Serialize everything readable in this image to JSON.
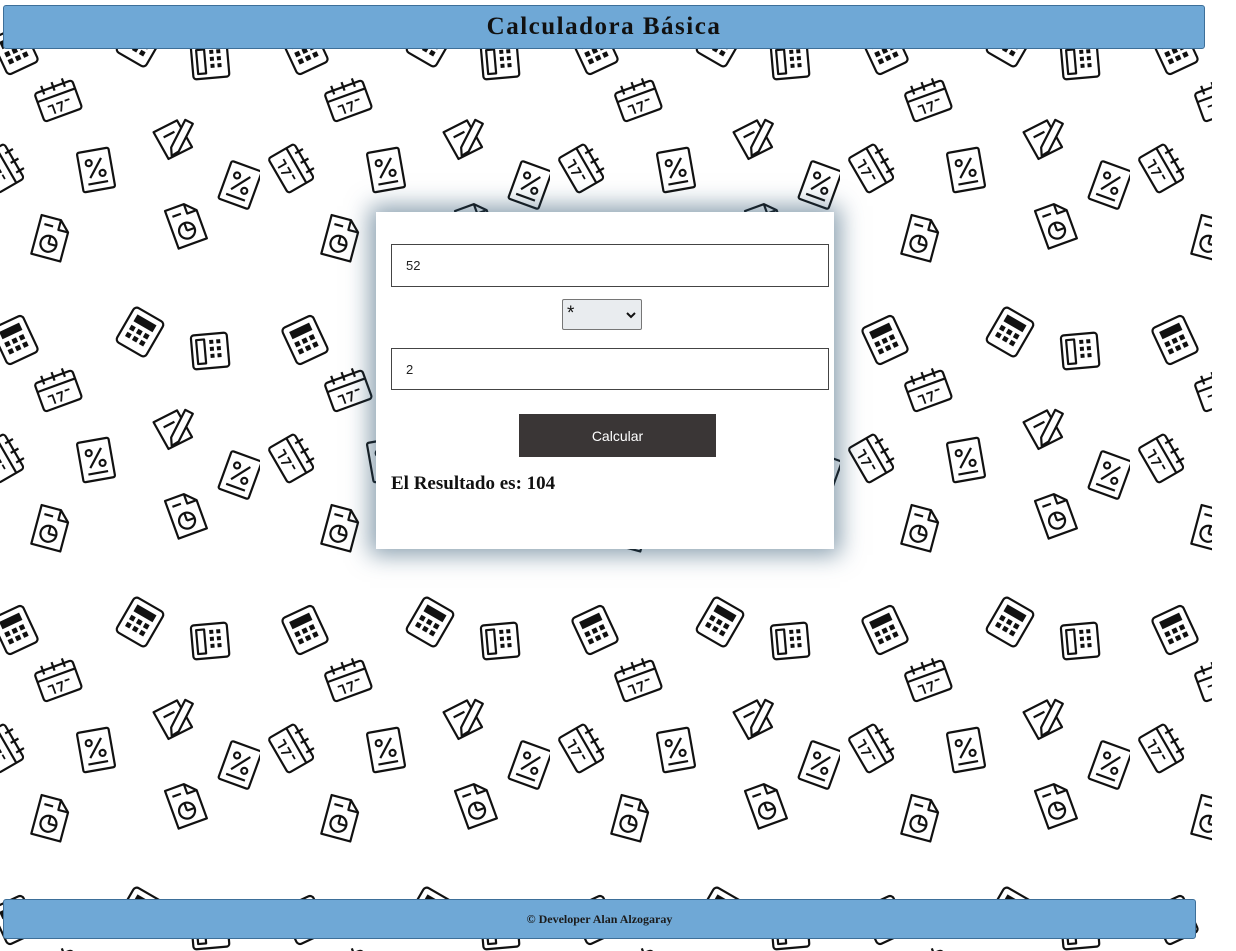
{
  "header": {
    "title": "Calculadora Básica"
  },
  "calculator": {
    "first_number": "52",
    "operator": "*",
    "second_number": "2",
    "calculate_label": "Calcular",
    "result_label": "El Resultado es: ",
    "result_value": "104"
  },
  "footer": {
    "credit": "© Developer Alan Alzogaray"
  },
  "background": {
    "pattern_icons": [
      "calculator-icon",
      "calendar-icon",
      "document-chart-icon",
      "percent-document-icon",
      "pencil-icon",
      "telephone-icon"
    ]
  },
  "colors": {
    "bar_blue": "#6fa8d6",
    "button_dark": "#3a3636",
    "card_shadow": "#28506e"
  }
}
